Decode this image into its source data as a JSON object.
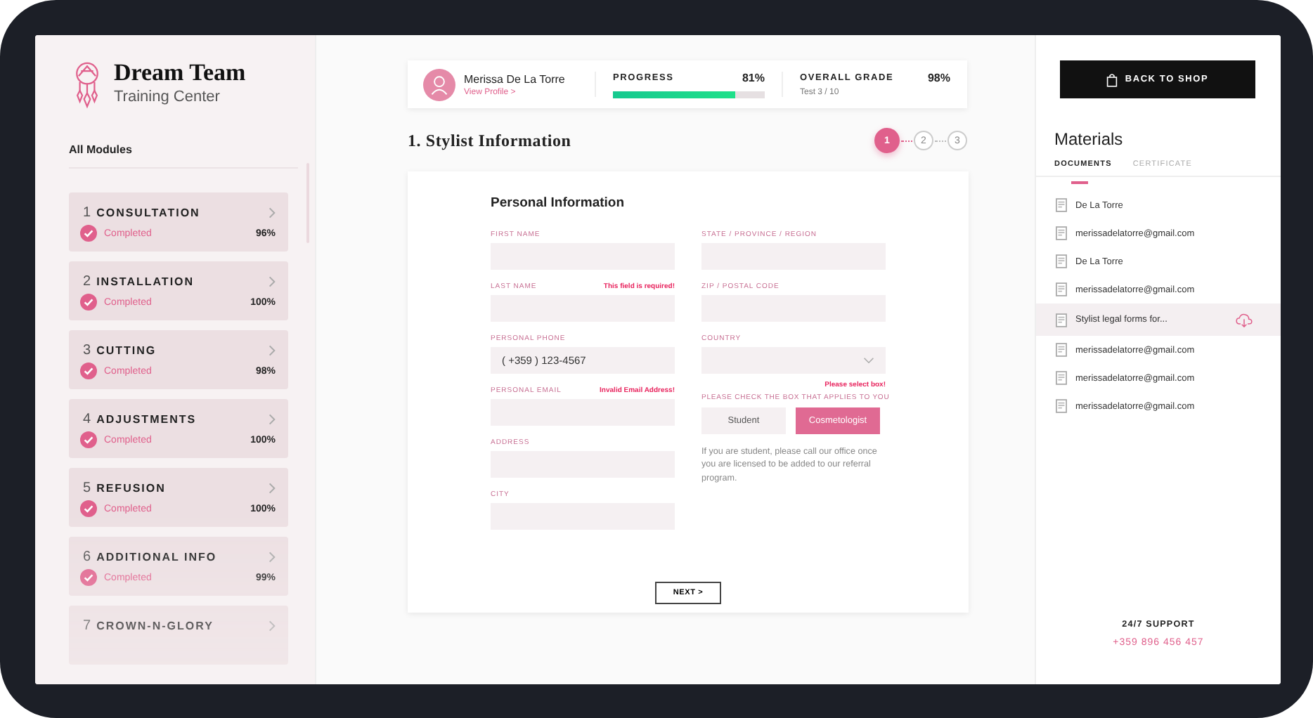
{
  "brand": {
    "title": "Dream Team",
    "subtitle": "Training Center"
  },
  "sidebar": {
    "heading": "All Modules",
    "modules": [
      {
        "number": "1",
        "title": "CONSULTATION",
        "status": "Completed",
        "percent": "96%",
        "completed": true
      },
      {
        "number": "2",
        "title": "INSTALLATION",
        "status": "Completed",
        "percent": "100%",
        "completed": true
      },
      {
        "number": "3",
        "title": "CUTTING",
        "status": "Completed",
        "percent": "98%",
        "completed": true
      },
      {
        "number": "4",
        "title": "ADJUSTMENTS",
        "status": "Completed",
        "percent": "100%",
        "completed": true
      },
      {
        "number": "5",
        "title": "REFUSION",
        "status": "Completed",
        "percent": "100%",
        "completed": true
      },
      {
        "number": "6",
        "title": "ADDITIONAL INFO",
        "status": "Completed",
        "percent": "99%",
        "completed": true
      },
      {
        "number": "7",
        "title": "CROWN-N-GLORY"
      }
    ]
  },
  "header": {
    "name": "Merissa De La Torre",
    "profile_link": "View Profile >",
    "progress_label": "PROGRESS",
    "progress_value": "81%",
    "level": 0.81,
    "grade_label": "OVERALL GRADE",
    "grade_value": "98%",
    "test": "Test  3 / 10"
  },
  "page_title": "1. Stylist Information",
  "steps": [
    {
      "label": "1",
      "selected": true
    },
    {
      "label": "2",
      "selected": false
    },
    {
      "label": "3",
      "selected": false
    }
  ],
  "form": {
    "title": "Personal Information",
    "left_fields": [
      {
        "label": "FIRST NAME"
      },
      {
        "label": "LAST NAME",
        "error": "This field is required!"
      },
      {
        "label": "PERSONAL PHONE",
        "value": "( +359 ) 123-4567"
      },
      {
        "label": "PERSONAL EMAIL",
        "error": "Invalid Email Address!"
      },
      {
        "label": "ADDRESS"
      },
      {
        "label": "CITY"
      }
    ],
    "right_fields": [
      {
        "label": "STATE / PROVINCE / REGION",
        "kind": "text"
      },
      {
        "label": "ZIP / POSTAL CODE",
        "kind": "text"
      },
      {
        "label": "COUNTRY",
        "kind": "select"
      }
    ],
    "choice_error": "Please select box!",
    "choice_label": "PLEASE CHECK THE BOX THAT APPLIES TO YOU",
    "choices": [
      {
        "label": "Student",
        "selected": false
      },
      {
        "label": "Cosmetologist",
        "selected": true
      }
    ],
    "note": "If you are student, please call our office once you are licensed to be added to our referral program.",
    "next_button": "NEXT >"
  },
  "right_panel": {
    "shop_button": "BACK TO SHOP",
    "title": "Materials",
    "tabs": [
      {
        "label": "DOCUMENTS",
        "selected": true
      },
      {
        "label": "CERTIFICATE",
        "selected": false
      }
    ],
    "documents": [
      {
        "name": "De La Torre",
        "selected": false
      },
      {
        "name": "merissadelatorre@gmail.com",
        "selected": false
      },
      {
        "name": "De La Torre",
        "selected": false
      },
      {
        "name": "merissadelatorre@gmail.com",
        "selected": false
      },
      {
        "name": "Stylist legal forms for...",
        "selected": true
      },
      {
        "name": "merissadelatorre@gmail.com",
        "selected": false
      },
      {
        "name": "merissadelatorre@gmail.com",
        "selected": false
      },
      {
        "name": "merissadelatorre@gmail.com",
        "selected": false
      }
    ],
    "support_label": "24/7 SUPPORT",
    "support_phone": "+359 896 456 457"
  }
}
